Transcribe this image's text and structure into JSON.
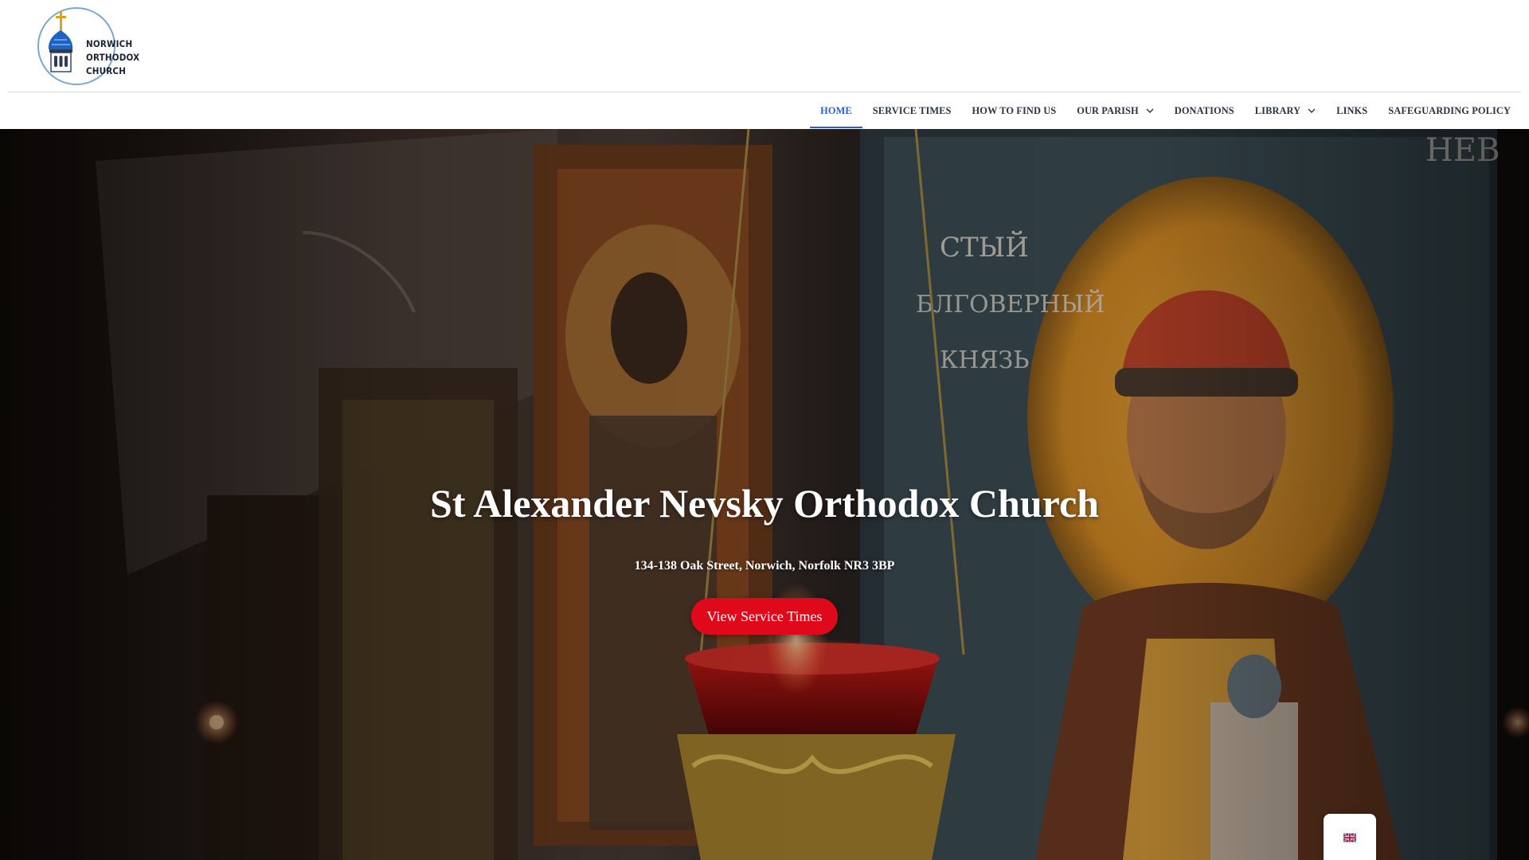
{
  "header": {
    "logo": {
      "line1": "NORWICH",
      "line2": "ORTHODOX",
      "line3": "CHURCH"
    }
  },
  "nav": {
    "items": [
      {
        "label": "HOME",
        "active": true,
        "has_dropdown": false
      },
      {
        "label": "SERVICE TIMES",
        "active": false,
        "has_dropdown": false
      },
      {
        "label": "HOW TO FIND US",
        "active": false,
        "has_dropdown": false
      },
      {
        "label": "OUR PARISH",
        "active": false,
        "has_dropdown": true
      },
      {
        "label": "DONATIONS",
        "active": false,
        "has_dropdown": false
      },
      {
        "label": "LIBRARY",
        "active": false,
        "has_dropdown": true
      },
      {
        "label": "LINKS",
        "active": false,
        "has_dropdown": false
      },
      {
        "label": "SAFEGUARDING POLICY",
        "active": false,
        "has_dropdown": false
      }
    ]
  },
  "hero": {
    "title": "St Alexander Nevsky Orthodox Church",
    "address": "134-138 Oak Street, Norwich, Norfolk NR3 3BP",
    "cta_label": "View Service Times",
    "background": "photo-icons-church-interior"
  },
  "language_switcher": {
    "icon": "uk-flag-icon"
  },
  "colors": {
    "nav_active": "#2a62c9",
    "nav_text": "#2b3440",
    "cta_background": "#e0081b",
    "hero_text": "#ffffff"
  }
}
